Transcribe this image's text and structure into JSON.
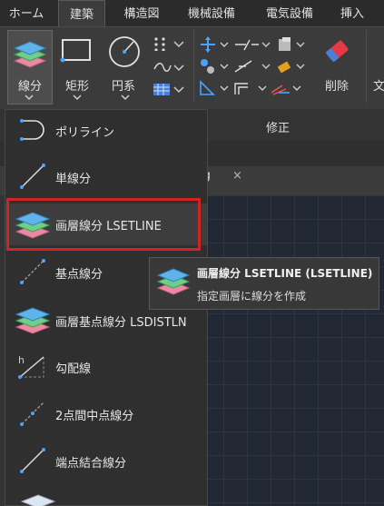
{
  "tabs": [
    "ホーム",
    "建築",
    "構造図",
    "機械設備",
    "電気設備",
    "挿入"
  ],
  "active_tab_index": 1,
  "ribbon": {
    "line_label": "線分",
    "rect_label": "矩形",
    "circle_label": "円系",
    "delete_label": "削除",
    "modify_panel_title": "修正",
    "cut_text": "文"
  },
  "file_tab": {
    "name": "wg",
    "close": "×"
  },
  "menu_items": [
    {
      "label": "ポリライン",
      "icon": "polyline-icon"
    },
    {
      "label": "単線分",
      "icon": "single-line-icon"
    },
    {
      "label": "画層線分 LSETLINE",
      "icon": "layer-line-icon"
    },
    {
      "label": "基点線分",
      "icon": "base-point-line-icon"
    },
    {
      "label": "画層基点線分 LSDISTLN",
      "icon": "layer-base-point-line-icon"
    },
    {
      "label": "勾配線",
      "icon": "slope-line-icon"
    },
    {
      "label": "2点間中点線分",
      "icon": "midpoint-line-icon"
    },
    {
      "label": "端点結合線分",
      "icon": "endpoint-join-line-icon"
    }
  ],
  "tooltip": {
    "title": "画層線分 LSETLINE (LSETLINE)",
    "description": "指定画層に線分を作成"
  },
  "colors": {
    "highlight_border": "#d32222",
    "layer_blue": "#5fb3e8",
    "layer_green": "#6fcf8a",
    "layer_pink": "#e88aa0"
  }
}
